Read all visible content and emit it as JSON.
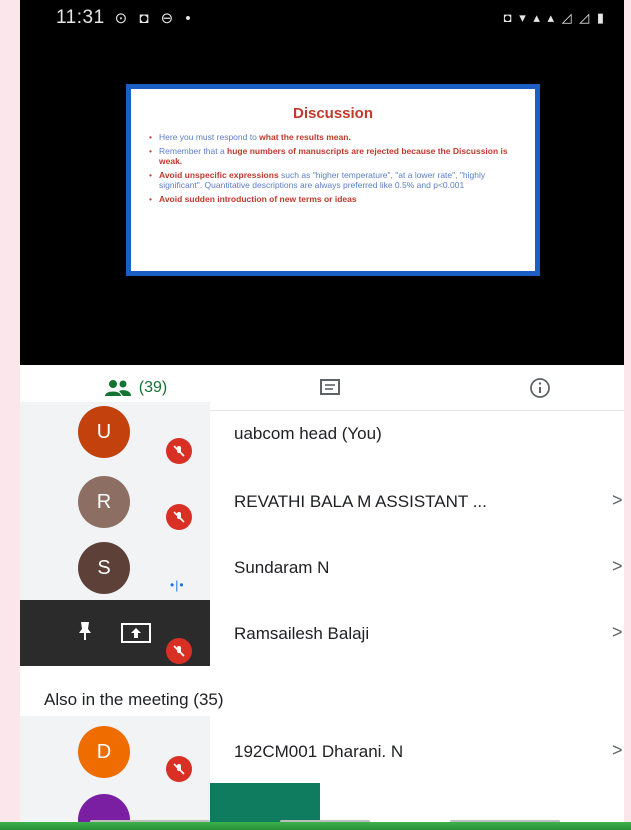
{
  "status_bar": {
    "time": "11:31",
    "left_icons": "⊙ ◘ ⊖ •",
    "right_icons": "◘ ▾ ▴ ▴ ◿ ◿ ▮"
  },
  "slide": {
    "title": "Discussion",
    "bullets": [
      {
        "plain": "Here you must respond to ",
        "bold": "what the results mean."
      },
      {
        "plain": "Remember that a ",
        "bold": "huge numbers of manuscripts are rejected because the Discussion is weak."
      },
      {
        "plain": "",
        "bold": "Avoid unspecific expressions",
        "after": " such as \"higher temperature\", \"at a lower rate\", \"highly significant\". Quantitative descriptions are always preferred like 0.5% and p<0.001"
      },
      {
        "plain": "",
        "bold": "Avoid sudden introduction of new terms or ideas"
      }
    ]
  },
  "tabs": {
    "people_count": "(39)",
    "chat_icon": "chat-icon",
    "info_icon": "info-icon"
  },
  "participants": [
    {
      "initial": "U",
      "name": "uabcom head (You)",
      "color": "#c2410c",
      "muted": true
    },
    {
      "initial": "R",
      "name": "REVATHI BALA M ASSISTANT ...",
      "color": "#8d6e63",
      "muted": true
    },
    {
      "initial": "S",
      "name": "Sundaram N",
      "color": "#5d4037",
      "muted": false
    },
    {
      "initial": "",
      "name": "Ramsailesh Balaji",
      "color": "#000000",
      "muted": true
    },
    {
      "initial": "D",
      "name": "192CM001 Dharani. N",
      "color": "#ef6c00",
      "muted": true
    }
  ],
  "section": {
    "also_in_meeting": "Also in the meeting (35)"
  },
  "chevron": ">",
  "colors": {
    "accent_green": "#137333",
    "mic_off_red": "#d93025",
    "slide_border": "#1b5fc6"
  }
}
